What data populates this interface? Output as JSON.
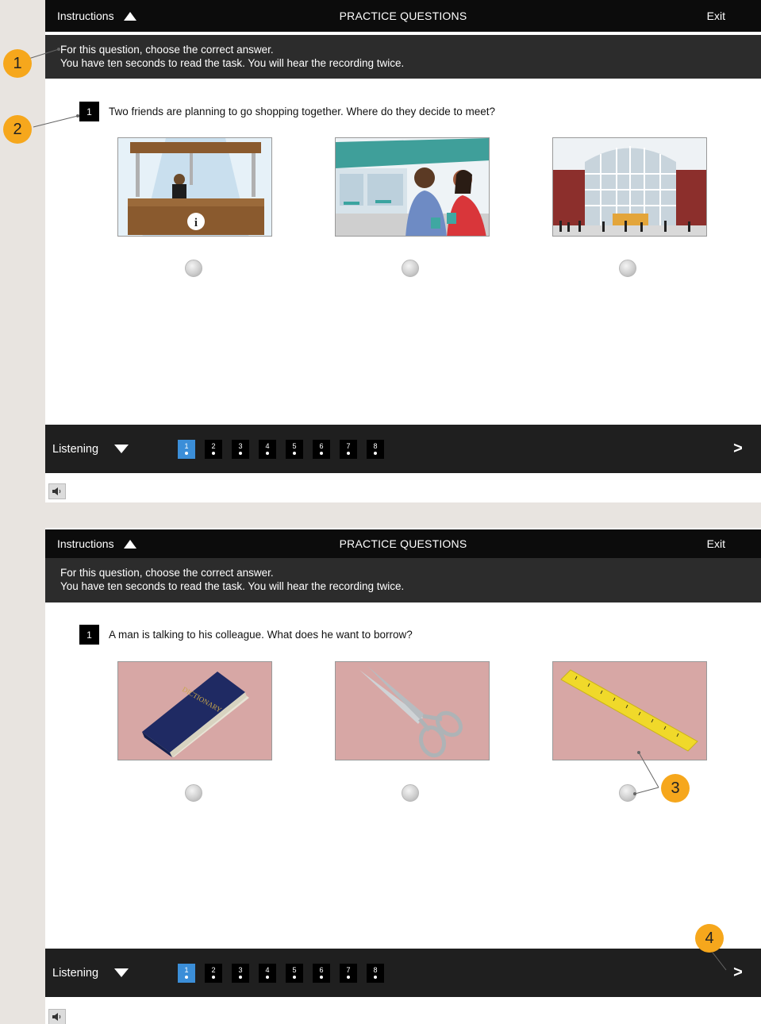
{
  "screen1": {
    "header": {
      "instructions_label": "Instructions",
      "title": "PRACTICE QUESTIONS",
      "exit_label": "Exit"
    },
    "instructions": [
      "For this question, choose the correct answer.",
      "You have ten seconds to read the task. You will hear the recording twice."
    ],
    "question": {
      "number": "1",
      "text": "Two friends are planning to go shopping together. Where do they decide to meet?"
    },
    "options": [
      {
        "image": "information-desk-illustration",
        "selected": false
      },
      {
        "image": "cafe-friends-illustration",
        "selected": false
      },
      {
        "image": "shopping-mall-entrance-illustration",
        "selected": false
      }
    ],
    "footer": {
      "section_label": "Listening",
      "pages": [
        "1",
        "2",
        "3",
        "4",
        "5",
        "6",
        "7",
        "8"
      ],
      "active_page": "1",
      "next_label": ">"
    }
  },
  "screen2": {
    "header": {
      "instructions_label": "Instructions",
      "title": "PRACTICE QUESTIONS",
      "exit_label": "Exit"
    },
    "instructions": [
      "For this question, choose the correct answer.",
      "You have ten seconds to read the task. You will hear the recording twice."
    ],
    "question": {
      "number": "1",
      "text": "A man is talking to his colleague. What does he want to borrow?"
    },
    "options": [
      {
        "image": "dictionary-photo",
        "book_title": "DICTIONARY",
        "selected": false
      },
      {
        "image": "scissors-photo",
        "selected": false
      },
      {
        "image": "ruler-photo",
        "selected": false
      }
    ],
    "footer": {
      "section_label": "Listening",
      "pages": [
        "1",
        "2",
        "3",
        "4",
        "5",
        "6",
        "7",
        "8"
      ],
      "active_page": "1",
      "next_label": ">"
    }
  },
  "callouts": [
    "1",
    "2",
    "3",
    "4"
  ],
  "colors": {
    "callout": "#f6a71c",
    "active_page": "#3b8ed8",
    "topbar": "#0c0c0c",
    "instructions_panel": "#2c2c2c",
    "footer": "#1f1f1f"
  }
}
